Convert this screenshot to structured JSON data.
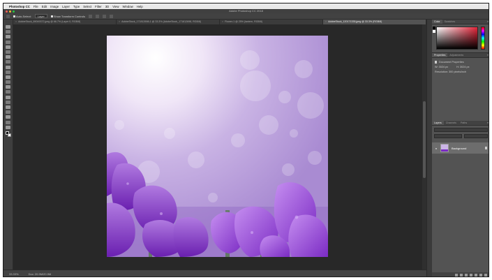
{
  "menubar": {
    "app_name": "Photoshop CC",
    "items": [
      "File",
      "Edit",
      "Image",
      "Layer",
      "Type",
      "Select",
      "Filter",
      "3D",
      "View",
      "Window",
      "Help"
    ]
  },
  "window": {
    "title": "Adobe Photoshop CC 2018"
  },
  "options": {
    "auto_select": "Auto-Select:",
    "auto_select_target": "Layer",
    "show_transform": "Show Transform Controls"
  },
  "tabs": [
    {
      "label": "AdobeStock_89049372.jpeg @ 66.7% (Layer 0, RGB/8)",
      "active": false
    },
    {
      "label": "AdobeStock_171812698-1 @ 33.3% (AdobeStock_171812698, RGB/8)",
      "active": false
    },
    {
      "label": "Flower-1 @ 25% (lantern, RGB/8)",
      "active": false
    },
    {
      "label": "AdobeStock_120171335.jpeg @ 33.3% (RGB/8)",
      "active": true
    }
  ],
  "status": {
    "zoom": "33.33%",
    "doc": "Doc: 20.9M/20.9M"
  },
  "panels": {
    "color_tabs": [
      "Color",
      "Swatches"
    ],
    "properties_tabs": [
      "Properties",
      "Adjustments"
    ],
    "properties_title": "Document Properties",
    "width": "W: 3024 px",
    "height": "H: 3024 px",
    "resolution": "Resolution: 300 pixels/inch",
    "layers_tabs": [
      "Layers",
      "Channels",
      "Paths"
    ],
    "layer_name": "Background"
  },
  "colors": {
    "accent_hue": "#e6253a",
    "canvas_bg": "#282828",
    "panel_bg": "#535353"
  }
}
